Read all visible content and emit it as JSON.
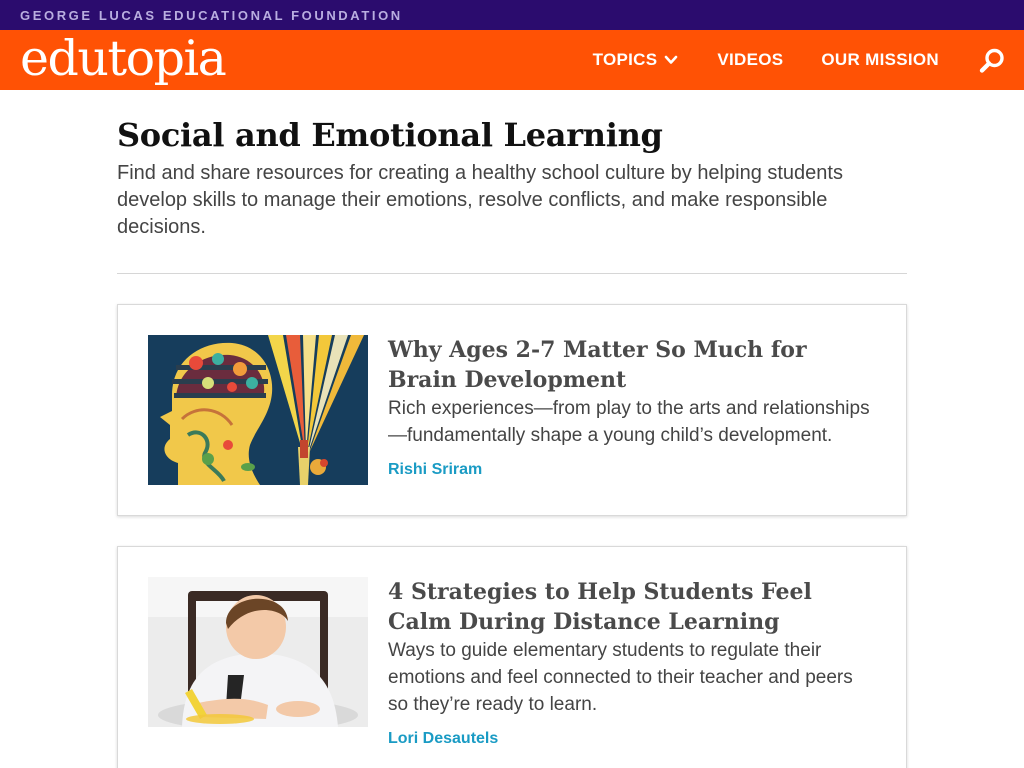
{
  "header": {
    "foundation": "GEORGE LUCAS EDUCATIONAL FOUNDATION",
    "logo": "edutopia",
    "nav": [
      {
        "label": "TOPICS"
      },
      {
        "label": "VIDEOS"
      },
      {
        "label": "OUR MISSION"
      }
    ],
    "icons": [
      "chevron-down-icon",
      "search-icon"
    ],
    "colors": {
      "top_bar": "#2b0c6e",
      "nav_bar": "#ff5205",
      "author_link": "#1a9bc4"
    }
  },
  "page": {
    "title": "Social and Emotional Learning",
    "description": "Find and share resources for creating a healthy school culture by helping students develop skills to manage their emotions, resolve conflicts, and make responsible decisions."
  },
  "articles": [
    {
      "title": "Why Ages 2-7 Matter So Much for Brain Development",
      "summary": "Rich experiences—from play to the arts and relationships—fundamentally shape a young child’s development.",
      "author": "Rishi Sriram"
    },
    {
      "title": "4 Strategies to Help Students Feel Calm During Distance Learning",
      "summary": "Ways to guide elementary students to regulate their emotions and feel connected to their teacher and peers so they’re ready to learn.",
      "author": "Lori Desautels"
    }
  ]
}
